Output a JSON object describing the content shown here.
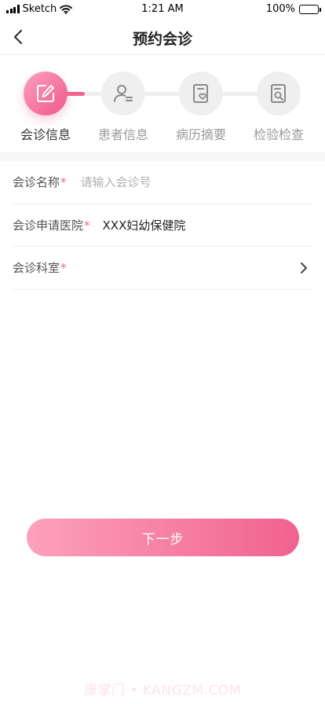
{
  "status_bar": {
    "carrier": "Sketch",
    "time": "1:21 AM",
    "battery": "100%",
    "icons": [
      "signal-icon",
      "wifi-icon",
      "battery-icon"
    ]
  },
  "nav": {
    "title": "预约会诊",
    "back_icon": "chevron-left-icon"
  },
  "steps": [
    {
      "label": "会诊信息",
      "icon": "edit-icon",
      "active": true
    },
    {
      "label": "患者信息",
      "icon": "user-icon",
      "active": false
    },
    {
      "label": "病历摘要",
      "icon": "record-icon",
      "active": false
    },
    {
      "label": "检验检查",
      "icon": "search-doc-icon",
      "active": false
    }
  ],
  "form": {
    "name_label": "会诊名称",
    "name_placeholder": "请输入会诊号",
    "hospital_label": "会诊申请医院",
    "hospital_value": "XXX妇幼保健院",
    "dept_label": "会诊科室",
    "required_mark": "*"
  },
  "next_button": "下一步",
  "watermark": "康掌门 • KANGZM.COM",
  "colors": {
    "accent": "#f2648e",
    "accent_light": "#fda1bd",
    "inactive": "#efefef"
  }
}
